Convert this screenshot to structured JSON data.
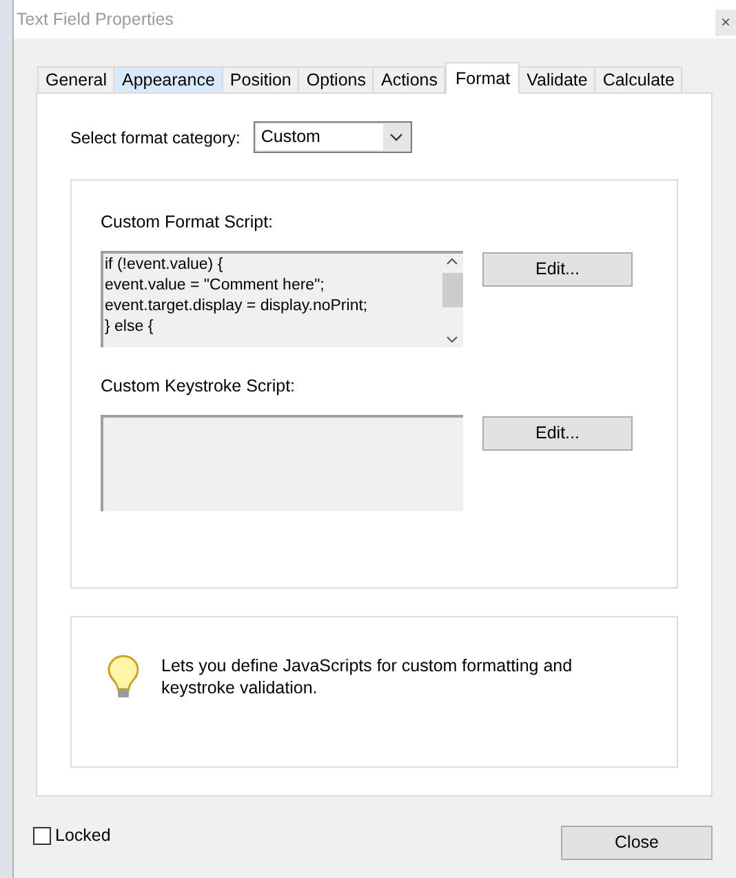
{
  "window": {
    "title": "Text Field Properties",
    "close": "×"
  },
  "tabs": [
    {
      "label": "General",
      "selected": false,
      "hovered": false
    },
    {
      "label": "Appearance",
      "selected": false,
      "hovered": true
    },
    {
      "label": "Position",
      "selected": false,
      "hovered": false
    },
    {
      "label": "Options",
      "selected": false,
      "hovered": false
    },
    {
      "label": "Actions",
      "selected": false,
      "hovered": false
    },
    {
      "label": "Format",
      "selected": true,
      "hovered": false
    },
    {
      "label": "Validate",
      "selected": false,
      "hovered": false
    },
    {
      "label": "Calculate",
      "selected": false,
      "hovered": false
    }
  ],
  "format_category": {
    "label": "Select format category:",
    "value": "Custom"
  },
  "scripts": [
    {
      "label": "Custom Format Script:",
      "lines": [
        "if (!event.value) {",
        "event.value = \"Comment here\";",
        "event.target.display = display.noPrint;",
        "} else {"
      ],
      "scrollbar": true,
      "button": "Edit..."
    },
    {
      "label": "Custom Keystroke Script:",
      "scrollbar": false,
      "button": "Edit..."
    }
  ],
  "info": "Lets you define JavaScripts for custom formatting and keystroke validation.",
  "locked": {
    "label": "Locked",
    "checked": false
  },
  "close_button": "Close"
}
